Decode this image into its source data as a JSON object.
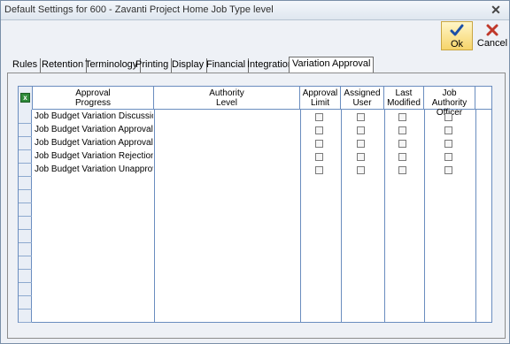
{
  "window": {
    "title": "Default Settings for 600 - Zavanti Project Home Job Type level",
    "close_glyph": "✕"
  },
  "toolbar": {
    "ok_label": "Ok",
    "ok_icon": "check-icon",
    "cancel_label": "Cancel",
    "cancel_icon": "x-icon"
  },
  "tabs": [
    {
      "label": "Rules"
    },
    {
      "label": "Retention"
    },
    {
      "label": "Terminology"
    },
    {
      "label": "Printing"
    },
    {
      "label": "Display"
    },
    {
      "label": "Financial"
    },
    {
      "label": "Integration"
    },
    {
      "label": "Variation Approval",
      "active": true
    }
  ],
  "grid": {
    "columns": [
      {
        "line1": "Approval",
        "line2": "Progress"
      },
      {
        "line1": "Authority",
        "line2": "Level"
      },
      {
        "line1": "Approval",
        "line2": "Limit"
      },
      {
        "line1": "Assigned",
        "line2": "User"
      },
      {
        "line1": "Last",
        "line2": "Modified"
      },
      {
        "line1": "Job Authority",
        "line2": "Officer"
      }
    ],
    "rows": [
      {
        "progress": "Job Budget Variation Discussion",
        "approval_limit": false,
        "assigned_user": false,
        "last_modified": false,
        "job_authority_officer": false
      },
      {
        "progress": "Job Budget Variation Approval",
        "approval_limit": false,
        "assigned_user": false,
        "last_modified": false,
        "job_authority_officer": false
      },
      {
        "progress": "Job Budget Variation Approval Rec",
        "approval_limit": false,
        "assigned_user": false,
        "last_modified": false,
        "job_authority_officer": false
      },
      {
        "progress": "Job Budget Variation Rejection",
        "approval_limit": false,
        "assigned_user": false,
        "last_modified": false,
        "job_authority_officer": false
      },
      {
        "progress": "Job Budget Variation Unapproval",
        "approval_limit": false,
        "assigned_user": false,
        "last_modified": false,
        "job_authority_officer": false
      }
    ],
    "export_icon": "excel-export-icon",
    "export_glyph": "x"
  },
  "colors": {
    "grid_border": "#6a8dbf",
    "ok_highlight": "#f6d46a",
    "window_bg": "#eef1f6"
  }
}
